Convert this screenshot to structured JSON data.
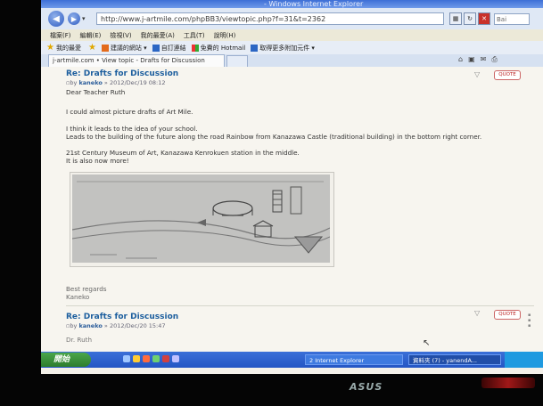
{
  "window": {
    "title_fragment": "- Windows Internet Explorer"
  },
  "address": {
    "url": "http://www.j-artmile.com/phpBB3/viewtopic.php?f=31&t=2362",
    "search_placeholder": "Bai"
  },
  "menu": [
    "檔案(F)",
    "編輯(E)",
    "檢視(V)",
    "我的最愛(A)",
    "工具(T)",
    "說明(H)"
  ],
  "favorites": {
    "label": "我的最愛",
    "items": [
      "建議的網站 ▾",
      "自訂連結",
      "免費的 Hotmail",
      "取得更多附加元件 ▾"
    ]
  },
  "tab": {
    "label": "j-artmile.com • View topic - Drafts for Discussion"
  },
  "post1": {
    "title": "Re: Drafts for Discussion",
    "by": "by",
    "author": "kaneko",
    "date": "» 2012/Dec/19 08:12",
    "greeting": "Dear    Teacher    Ruth",
    "p1": "I could almost picture drafts of Art Mile.",
    "p2": "I think it leads to the idea of your school.",
    "p3": "Leads to the building of the future along the road Rainbow from Kanazawa Castle (traditional building) in the bottom right corner.",
    "p4": "21st Century Museum of Art, Kanazawa Kenrokuen station in the middle.",
    "p5": "It is also now more!",
    "closing": "Best regards",
    "signature": "Kaneko",
    "quote_label": "QUOTE"
  },
  "post2": {
    "title": "Re: Drafts for Discussion",
    "by": "by",
    "author": "kaneko",
    "date": "» 2012/Dec/20 15:47",
    "greeting": "Dr. Ruth",
    "quote_label": "QUOTE"
  },
  "taskbar": {
    "start_label": "開始",
    "items": [
      "2 Internet Explorer",
      "資料夾 (7) - yanendA..."
    ]
  },
  "monitor": {
    "brand": "ASUS"
  },
  "colors": {
    "accent": "#1c5e9e",
    "taskbar": "#2456c4",
    "quote": "#b22222"
  }
}
